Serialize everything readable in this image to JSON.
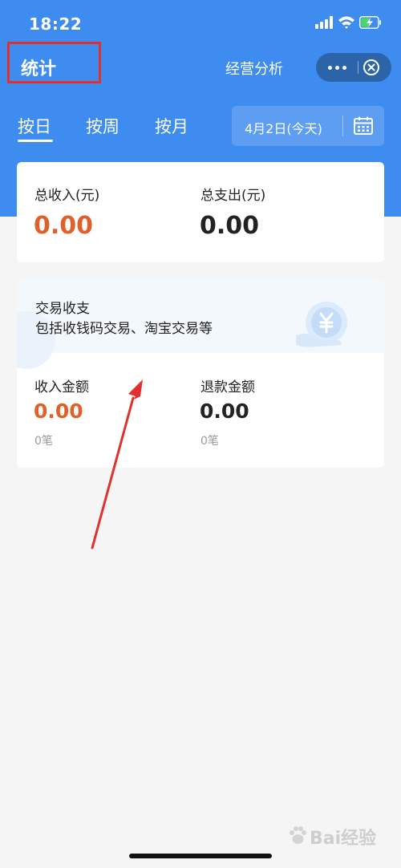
{
  "status_bar": {
    "time": "18:22"
  },
  "header": {
    "title": "统计",
    "analysis_link": "经营分析"
  },
  "tabs": [
    {
      "label": "按日",
      "selected": true
    },
    {
      "label": "按周",
      "selected": false
    },
    {
      "label": "按月",
      "selected": false
    }
  ],
  "date_picker": {
    "label": "4月2日(今天)"
  },
  "summary": {
    "income_label": "总收入(元)",
    "income_value": "0.00",
    "expense_label": "总支出(元)",
    "expense_value": "0.00"
  },
  "trade": {
    "title": "交易收支",
    "subtitle": "包括收钱码交易、淘宝交易等",
    "income_label": "收入金额",
    "income_value": "0.00",
    "income_count": "0笔",
    "refund_label": "退款金额",
    "refund_value": "0.00",
    "refund_count": "0笔"
  },
  "colors": {
    "header_blue": "#3f8cf0",
    "income_orange": "#e0602a",
    "annotation_red": "#e0312f"
  },
  "watermark": "Bai经验"
}
